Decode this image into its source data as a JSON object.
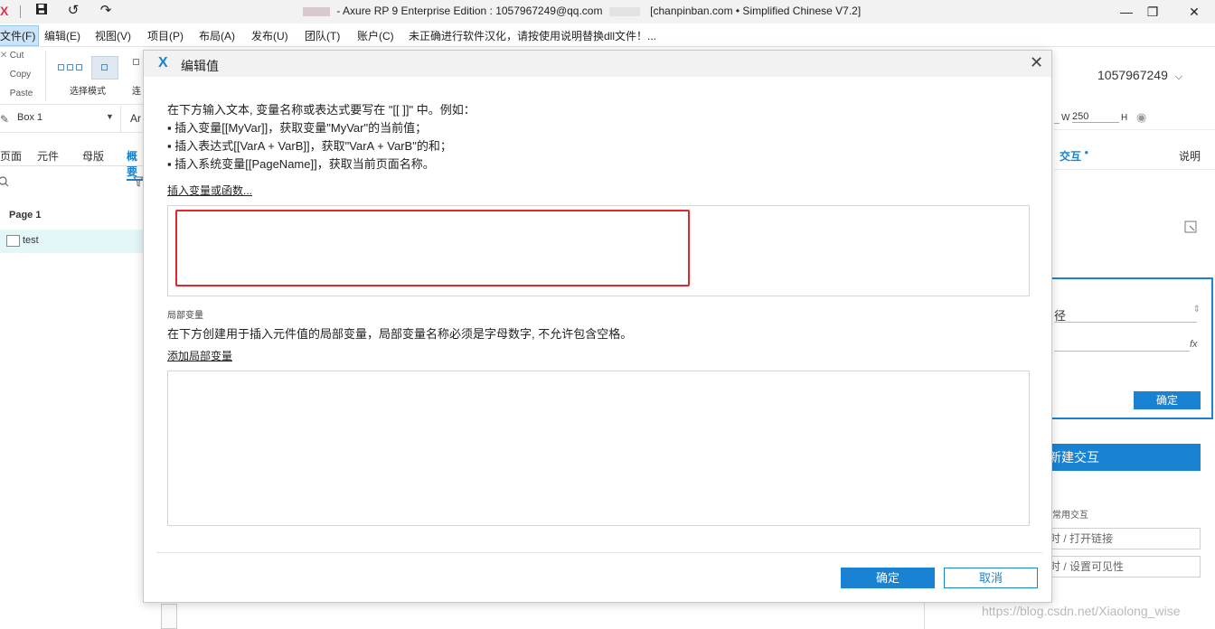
{
  "titlebar": {
    "title_prefix": "- Axure RP 9 Enterprise Edition : 1057967249@qq.com",
    "title_suffix": "[chanpinban.com • Simplified Chinese V7.2]",
    "minimize": "—",
    "maximize": "❐",
    "close": "✕"
  },
  "menu": {
    "items": [
      "文件(F)",
      "编辑(E)",
      "视图(V)",
      "项目(P)",
      "布局(A)",
      "发布(U)",
      "团队(T)",
      "账户(C)",
      "未正确进行软件汉化，请按使用说明替换dll文件！..."
    ]
  },
  "toolbar": {
    "cut": "Cut",
    "copy": "Copy",
    "paste": "Paste",
    "select_mode": "选择模式",
    "connect": "连"
  },
  "widgetbar": {
    "widget_name": "Box 1",
    "font": "Ar"
  },
  "left_panel": {
    "tabs": [
      "页面",
      "元件",
      "母版",
      "概要"
    ],
    "root_page": "Page 1",
    "child_page": "test"
  },
  "right_panel": {
    "user": "1057967249",
    "w_label": "W",
    "w_value": "250",
    "h_label": "H",
    "tab_interaction": "交互",
    "tab_note": "说明",
    "field_path": "径",
    "fx": "fx",
    "ok_small": "确定",
    "new_interaction": "新建交互",
    "common_label": "常用交互",
    "option1": "时 / 打开链接",
    "option2": "时 / 设置可见性"
  },
  "dialog": {
    "title": "编辑值",
    "intro_line1": "在下方输入文本, 变量名称或表达式要写在 \"[[ ]]\" 中。例如：",
    "intro_line2": "▪ 插入变量[[MyVar]]，获取变量\"MyVar\"的当前值；",
    "intro_line3": "▪ 插入表达式[[VarA + VarB]]，获取\"VarA + VarB\"的和；",
    "intro_line4": "▪ 插入系统变量[[PageName]]，获取当前页面名称。",
    "insert_link": "插入变量或函数...",
    "editor_value": "",
    "local_vars_label": "局部变量",
    "local_vars_desc": "在下方创建用于插入元件值的局部变量，局部变量名称必须是字母数字, 不允许包含空格。",
    "add_local_var": "添加局部变量",
    "ok": "确定",
    "cancel": "取消"
  },
  "watermark": "https://blog.csdn.net/Xiaolong_wise",
  "colors": {
    "accent": "#1a82d2",
    "highlight": "#e3262b"
  }
}
